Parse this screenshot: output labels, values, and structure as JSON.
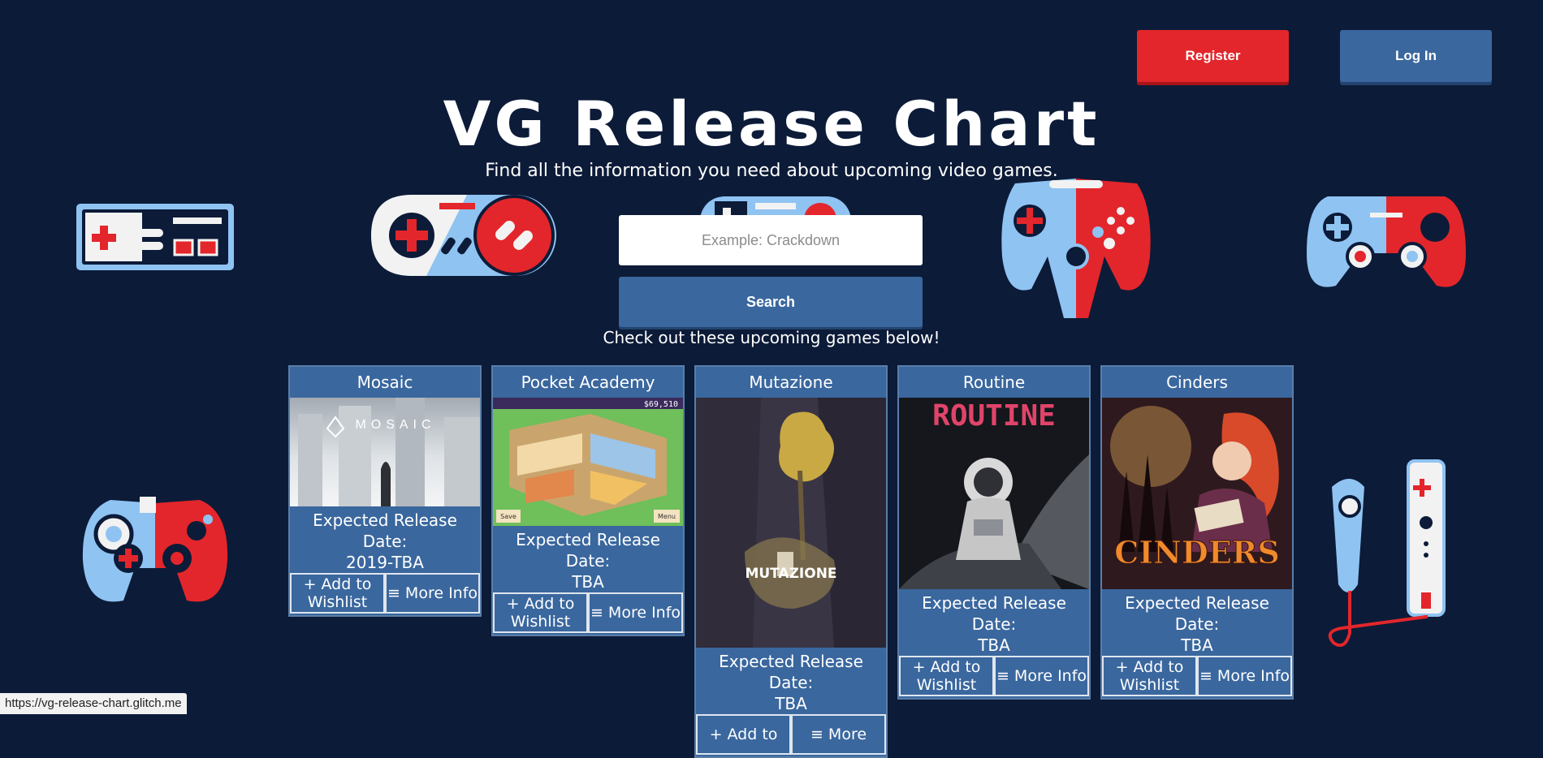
{
  "header": {
    "register_label": "Register",
    "login_label": "Log In",
    "title": "VG Release Chart",
    "subtitle": "Find all the information you need about upcoming video games."
  },
  "search": {
    "placeholder": "Example: Crackdown",
    "button_label": "Search"
  },
  "upcoming_label": "Check out these upcoming games below!",
  "games": [
    {
      "title": "Mosaic",
      "image_logo_text": "MOSAIC",
      "date_label": "Expected Release Date:",
      "date": "2019-TBA",
      "wishlist_label": "+ Add to Wishlist",
      "info_label": "≡ More Info"
    },
    {
      "title": "Pocket Academy",
      "image_money_text": "$69,510",
      "image_save_text": "Save",
      "image_menu_text": "Menu",
      "date_label": "Expected Release Date:",
      "date": "TBA",
      "wishlist_label": "+ Add to Wishlist",
      "info_label": "≡ More Info"
    },
    {
      "title": "Mutazione",
      "image_logo_text": "MUTAZIONE",
      "date_label": "Expected Release Date:",
      "date": "TBA",
      "wishlist_label": "+ Add to",
      "info_label": "≡ More"
    },
    {
      "title": "Routine",
      "image_logo_text": "ROUTINE",
      "date_label": "Expected Release Date:",
      "date": "TBA",
      "wishlist_label": "+ Add to Wishlist",
      "info_label": "≡ More Info"
    },
    {
      "title": "Cinders",
      "image_logo_text": "CINDERS",
      "date_label": "Expected Release Date:",
      "date": "TBA",
      "wishlist_label": "+ Add to Wishlist",
      "info_label": "≡ More Info"
    }
  ],
  "status_bar": {
    "url": "https://vg-release-chart.glitch.me"
  },
  "colors": {
    "background": "#0c1b38",
    "accent_blue": "#3a679e",
    "accent_red": "#e3262b",
    "light_blue": "#8fc3f2"
  },
  "icons": [
    "nes-controller-icon",
    "snes-controller-icon",
    "controller-icon",
    "n64-controller-icon",
    "modern-controller-icon",
    "gamecube-controller-icon",
    "wii-remote-icon"
  ]
}
